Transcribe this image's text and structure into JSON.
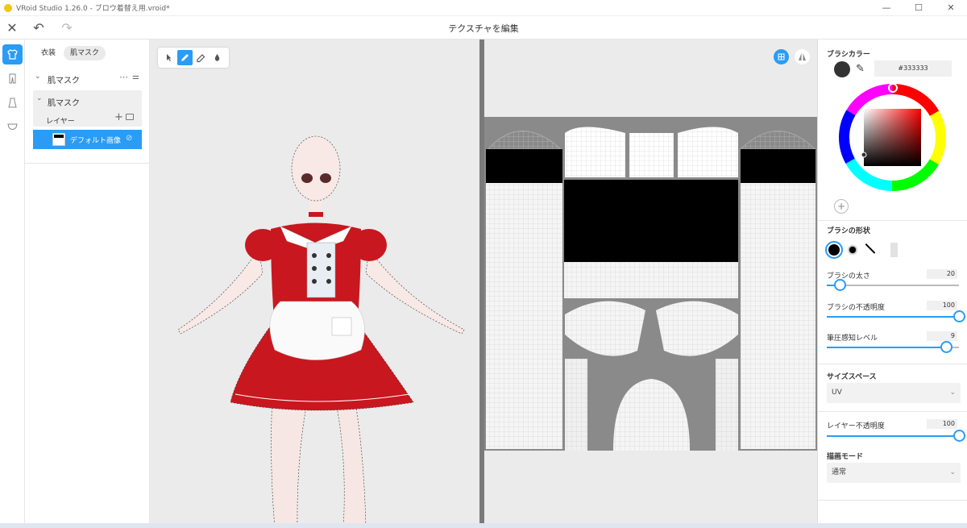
{
  "window": {
    "title": "VRoid Studio 1.26.0 - ブロウ着替え用.vroid*",
    "minimize": "—",
    "maximize": "☐",
    "close": "✕"
  },
  "toolbar": {
    "title": "テクスチャを編集",
    "close_icon": "close-icon",
    "undo_icon": "undo-icon",
    "redo_icon": "redo-icon"
  },
  "rail": {
    "items": [
      "shirt-icon",
      "pants-icon",
      "dress-icon",
      "accessory-icon"
    ]
  },
  "panel": {
    "tabs": [
      "衣装",
      "肌マスク"
    ],
    "active_tab": "肌マスク",
    "group_title": "肌マスク",
    "subgroup_title": "肌マスク",
    "layer_header": "レイヤー",
    "layers": [
      {
        "name": "デフォルト画像",
        "selected": true
      }
    ]
  },
  "viewport": {
    "tools": [
      "select-tool",
      "pen-tool",
      "eraser-tool",
      "fill-tool"
    ],
    "active_tool": "pen-tool"
  },
  "texture_view": {
    "buttons": [
      "grid-view-icon",
      "mirror-icon"
    ],
    "active_button": "grid-view-icon"
  },
  "brush": {
    "color_label": "ブラシカラー",
    "color_hex": "#333333",
    "shape_label": "ブラシの形状",
    "size_label": "ブラシの太さ",
    "size_value": "20",
    "size_fraction": 0.1,
    "opacity_label": "ブラシの不透明度",
    "opacity_value": "100",
    "opacity_fraction": 1.0,
    "pressure_label": "筆圧感知レベル",
    "pressure_value": "9",
    "pressure_fraction": 0.9,
    "size_space_label": "サイズスペース",
    "size_space_value": "UV",
    "layer_opacity_label": "レイヤー不透明度",
    "layer_opacity_value": "100",
    "layer_opacity_fraction": 1.0,
    "blend_mode_label": "描画モード",
    "blend_mode_value": "通常"
  },
  "colors": {
    "accent": "#2a9cf5",
    "dress_red": "#c8171e",
    "brush_color": "#333333"
  }
}
